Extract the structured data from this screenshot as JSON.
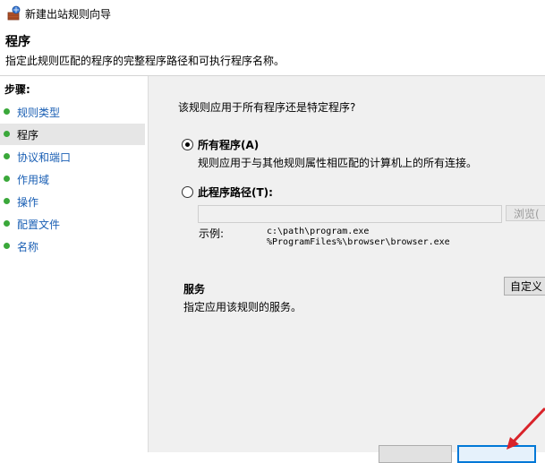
{
  "window": {
    "title": "新建出站规则向导"
  },
  "header": {
    "title": "程序",
    "description": "指定此规则匹配的程序的完整程序路径和可执行程序名称。"
  },
  "sidebar": {
    "heading": "步骤:",
    "items": [
      {
        "label": "规则类型"
      },
      {
        "label": "程序"
      },
      {
        "label": "协议和端口"
      },
      {
        "label": "作用域"
      },
      {
        "label": "操作"
      },
      {
        "label": "配置文件"
      },
      {
        "label": "名称"
      }
    ],
    "active_index": 1
  },
  "main": {
    "question": "该规则应用于所有程序还是特定程序?",
    "all_programs": {
      "label": "所有程序(A)",
      "description": "规则应用于与其他规则属性相匹配的计算机上的所有连接。",
      "selected": true
    },
    "program_path": {
      "label": "此程序路径(T):",
      "value": "",
      "browse_label": "浏览(",
      "example_label": "示例:",
      "example_lines": [
        "c:\\path\\program.exe",
        "%ProgramFiles%\\browser\\browser.exe"
      ],
      "selected": false
    },
    "services": {
      "title": "服务",
      "description": "指定应用该规则的服务。",
      "customize_label": "自定义"
    }
  },
  "colors": {
    "step_link": "#1a5fb4",
    "step_dot": "#3aa83a",
    "primary_border": "#0078d7",
    "annotation_arrow": "#d9232a"
  }
}
